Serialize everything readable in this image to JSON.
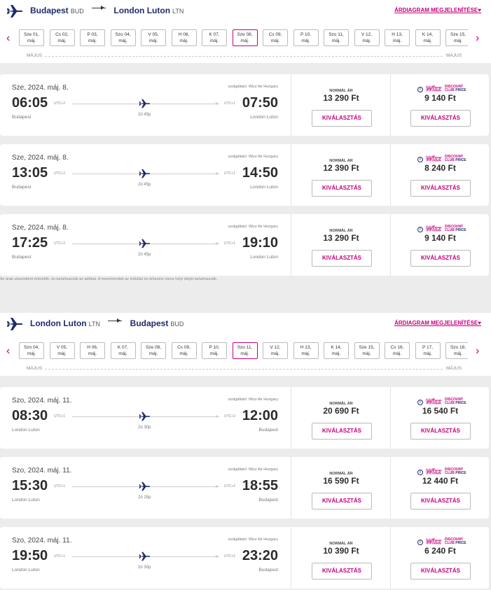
{
  "colors": {
    "brand_pink": "#c6007e",
    "brand_navy": "#1f2a6b"
  },
  "outbound": {
    "from_city": "Budapest",
    "from_code": "BUD",
    "to_city": "London Luton",
    "to_code": "LTN",
    "price_chart_link": "ÁRDIAGRAM MEGJELENÍTÉSE♥",
    "month_left": "MÁJUS",
    "month_right": "MÁJUS",
    "dates": [
      {
        "d": "Sze 01,",
        "m": "máj."
      },
      {
        "d": "Cs 02,",
        "m": "máj."
      },
      {
        "d": "P 03,",
        "m": "máj."
      },
      {
        "d": "Szo 04,",
        "m": "máj."
      },
      {
        "d": "V 05,",
        "m": "máj."
      },
      {
        "d": "H 06,",
        "m": "máj."
      },
      {
        "d": "K 07,",
        "m": "máj."
      },
      {
        "d": "Sze 08,",
        "m": "máj."
      },
      {
        "d": "Cs 09,",
        "m": "máj."
      },
      {
        "d": "P 10,",
        "m": "máj."
      },
      {
        "d": "Szo 11,",
        "m": "máj."
      },
      {
        "d": "V 12,",
        "m": "máj."
      },
      {
        "d": "H 13,",
        "m": "máj."
      },
      {
        "d": "K 14,",
        "m": "máj."
      },
      {
        "d": "Sze 15,",
        "m": "máj."
      }
    ],
    "active_date_index": 7,
    "flights": [
      {
        "date": "Sze, 2024. máj. 8.",
        "dep": "06:05",
        "arr": "07:50",
        "utc_dep": "UTC+2",
        "utc_arr": "UTC+1",
        "duration": "2ó 45p",
        "from": "Budapest",
        "to": "London Luton",
        "operator": "szolgáltató: Wizz Air Hungary",
        "normal_price": "13 290 Ft",
        "club_price": "9 140 Ft"
      },
      {
        "date": "Sze, 2024. máj. 8.",
        "dep": "13:05",
        "arr": "14:50",
        "utc_dep": "UTC+2",
        "utc_arr": "UTC+1",
        "duration": "2ó 45p",
        "from": "Budapest",
        "to": "London Luton",
        "operator": "szolgáltató: Wizz Air Hungary",
        "normal_price": "12 390 Ft",
        "club_price": "8 240 Ft"
      },
      {
        "date": "Sze, 2024. máj. 8.",
        "dep": "17:25",
        "arr": "19:10",
        "utc_dep": "UTC+2",
        "utc_arr": "UTC+1",
        "duration": "2ó 45p",
        "from": "Budapest",
        "to": "London Luton",
        "operator": "szolgáltató: Wizz Air Hungary",
        "normal_price": "13 290 Ft",
        "club_price": "9 140 Ft"
      }
    ],
    "note": "Az árak utasonként értendők, és tartalmazzák az adókat. A menetrendek az indulási és érkezési város helyi idejét tartalmazzák."
  },
  "inbound": {
    "from_city": "London Luton",
    "from_code": "LTN",
    "to_city": "Budapest",
    "to_code": "BUD",
    "price_chart_link": "ÁRDIAGRAM MEGJELENÍTÉSE♥",
    "month_left": "MÁJUS",
    "month_right": "MÁJUS",
    "dates": [
      {
        "d": "Szo 04,",
        "m": "máj."
      },
      {
        "d": "V 05,",
        "m": "máj."
      },
      {
        "d": "H 06,",
        "m": "máj."
      },
      {
        "d": "K 07,",
        "m": "máj."
      },
      {
        "d": "Sze 08,",
        "m": "máj."
      },
      {
        "d": "Cs 09,",
        "m": "máj."
      },
      {
        "d": "P 10,",
        "m": "máj."
      },
      {
        "d": "Szo 11,",
        "m": "máj."
      },
      {
        "d": "V 12,",
        "m": "máj."
      },
      {
        "d": "H 13,",
        "m": "máj."
      },
      {
        "d": "K 14,",
        "m": "máj."
      },
      {
        "d": "Sze 15,",
        "m": "máj."
      },
      {
        "d": "Cs 16,",
        "m": "máj."
      },
      {
        "d": "P 17,",
        "m": "máj."
      },
      {
        "d": "Szo 18,",
        "m": "máj."
      }
    ],
    "active_date_index": 7,
    "flights": [
      {
        "date": "Szo, 2024. máj. 11.",
        "dep": "08:30",
        "arr": "12:00",
        "utc_dep": "UTC+1",
        "utc_arr": "UTC+2",
        "duration": "2ó 30p",
        "from": "London Luton",
        "to": "Budapest",
        "operator": "szolgáltató: Wizz Air Hungary",
        "normal_price": "20 690 Ft",
        "club_price": "16 540 Ft"
      },
      {
        "date": "Szo, 2024. máj. 11.",
        "dep": "15:30",
        "arr": "18:55",
        "utc_dep": "UTC+1",
        "utc_arr": "UTC+2",
        "duration": "2ó 25p",
        "from": "London Luton",
        "to": "Budapest",
        "operator": "szolgáltató: Wizz Air Hungary",
        "normal_price": "16 590 Ft",
        "club_price": "12 440 Ft"
      },
      {
        "date": "Szo, 2024. máj. 11.",
        "dep": "19:50",
        "arr": "23:20",
        "utc_dep": "UTC+1",
        "utc_arr": "UTC+2",
        "duration": "2ó 30p",
        "from": "London Luton",
        "to": "Budapest",
        "operator": "szolgáltató: Wizz Air Hungary",
        "normal_price": "10 390 Ft",
        "club_price": "6 240 Ft"
      }
    ]
  },
  "labels": {
    "normal_price": "NORMÁL ÁR",
    "select": "KIVÁLASZTÁS",
    "club_logo_wizz": "Wizz",
    "club_logo_line1": "DISCOUNT",
    "club_logo_line2": "CLUB",
    "club_logo_line3": "PRICE",
    "club_info": "i",
    "prev": "‹",
    "next": "›"
  }
}
